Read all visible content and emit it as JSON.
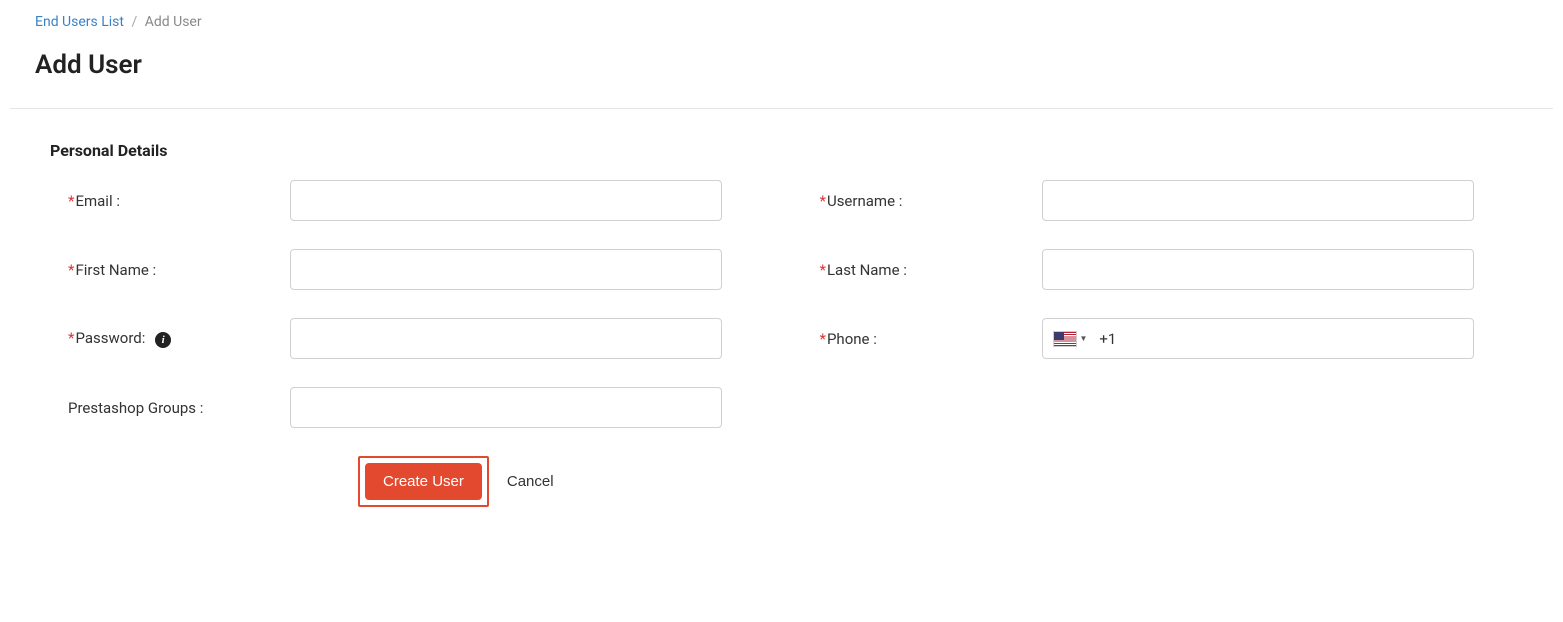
{
  "breadcrumb": {
    "parent": "End Users List",
    "separator": "/",
    "current": "Add User"
  },
  "page": {
    "title": "Add User"
  },
  "section": {
    "title": "Personal Details"
  },
  "labels": {
    "email": "Email :",
    "username": "Username :",
    "firstname": "First Name :",
    "lastname": "Last Name :",
    "password": "Password:",
    "phone": "Phone :",
    "groups": "Prestashop Groups :"
  },
  "phone": {
    "dial_code": "+1",
    "country": "US"
  },
  "buttons": {
    "create": "Create User",
    "cancel": "Cancel"
  },
  "info_icon_text": "i"
}
